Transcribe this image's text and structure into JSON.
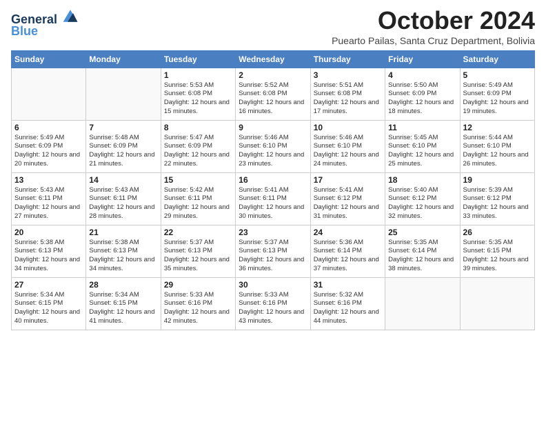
{
  "header": {
    "logo_line1": "General",
    "logo_line2": "Blue",
    "month_title": "October 2024",
    "subtitle": "Puearto Pailas, Santa Cruz Department, Bolivia"
  },
  "weekdays": [
    "Sunday",
    "Monday",
    "Tuesday",
    "Wednesday",
    "Thursday",
    "Friday",
    "Saturday"
  ],
  "weeks": [
    [
      {
        "day": "",
        "info": ""
      },
      {
        "day": "",
        "info": ""
      },
      {
        "day": "1",
        "info": "Sunrise: 5:53 AM\nSunset: 6:08 PM\nDaylight: 12 hours and 15 minutes."
      },
      {
        "day": "2",
        "info": "Sunrise: 5:52 AM\nSunset: 6:08 PM\nDaylight: 12 hours and 16 minutes."
      },
      {
        "day": "3",
        "info": "Sunrise: 5:51 AM\nSunset: 6:08 PM\nDaylight: 12 hours and 17 minutes."
      },
      {
        "day": "4",
        "info": "Sunrise: 5:50 AM\nSunset: 6:09 PM\nDaylight: 12 hours and 18 minutes."
      },
      {
        "day": "5",
        "info": "Sunrise: 5:49 AM\nSunset: 6:09 PM\nDaylight: 12 hours and 19 minutes."
      }
    ],
    [
      {
        "day": "6",
        "info": "Sunrise: 5:49 AM\nSunset: 6:09 PM\nDaylight: 12 hours and 20 minutes."
      },
      {
        "day": "7",
        "info": "Sunrise: 5:48 AM\nSunset: 6:09 PM\nDaylight: 12 hours and 21 minutes."
      },
      {
        "day": "8",
        "info": "Sunrise: 5:47 AM\nSunset: 6:09 PM\nDaylight: 12 hours and 22 minutes."
      },
      {
        "day": "9",
        "info": "Sunrise: 5:46 AM\nSunset: 6:10 PM\nDaylight: 12 hours and 23 minutes."
      },
      {
        "day": "10",
        "info": "Sunrise: 5:46 AM\nSunset: 6:10 PM\nDaylight: 12 hours and 24 minutes."
      },
      {
        "day": "11",
        "info": "Sunrise: 5:45 AM\nSunset: 6:10 PM\nDaylight: 12 hours and 25 minutes."
      },
      {
        "day": "12",
        "info": "Sunrise: 5:44 AM\nSunset: 6:10 PM\nDaylight: 12 hours and 26 minutes."
      }
    ],
    [
      {
        "day": "13",
        "info": "Sunrise: 5:43 AM\nSunset: 6:11 PM\nDaylight: 12 hours and 27 minutes."
      },
      {
        "day": "14",
        "info": "Sunrise: 5:43 AM\nSunset: 6:11 PM\nDaylight: 12 hours and 28 minutes."
      },
      {
        "day": "15",
        "info": "Sunrise: 5:42 AM\nSunset: 6:11 PM\nDaylight: 12 hours and 29 minutes."
      },
      {
        "day": "16",
        "info": "Sunrise: 5:41 AM\nSunset: 6:11 PM\nDaylight: 12 hours and 30 minutes."
      },
      {
        "day": "17",
        "info": "Sunrise: 5:41 AM\nSunset: 6:12 PM\nDaylight: 12 hours and 31 minutes."
      },
      {
        "day": "18",
        "info": "Sunrise: 5:40 AM\nSunset: 6:12 PM\nDaylight: 12 hours and 32 minutes."
      },
      {
        "day": "19",
        "info": "Sunrise: 5:39 AM\nSunset: 6:12 PM\nDaylight: 12 hours and 33 minutes."
      }
    ],
    [
      {
        "day": "20",
        "info": "Sunrise: 5:38 AM\nSunset: 6:13 PM\nDaylight: 12 hours and 34 minutes."
      },
      {
        "day": "21",
        "info": "Sunrise: 5:38 AM\nSunset: 6:13 PM\nDaylight: 12 hours and 34 minutes."
      },
      {
        "day": "22",
        "info": "Sunrise: 5:37 AM\nSunset: 6:13 PM\nDaylight: 12 hours and 35 minutes."
      },
      {
        "day": "23",
        "info": "Sunrise: 5:37 AM\nSunset: 6:13 PM\nDaylight: 12 hours and 36 minutes."
      },
      {
        "day": "24",
        "info": "Sunrise: 5:36 AM\nSunset: 6:14 PM\nDaylight: 12 hours and 37 minutes."
      },
      {
        "day": "25",
        "info": "Sunrise: 5:35 AM\nSunset: 6:14 PM\nDaylight: 12 hours and 38 minutes."
      },
      {
        "day": "26",
        "info": "Sunrise: 5:35 AM\nSunset: 6:15 PM\nDaylight: 12 hours and 39 minutes."
      }
    ],
    [
      {
        "day": "27",
        "info": "Sunrise: 5:34 AM\nSunset: 6:15 PM\nDaylight: 12 hours and 40 minutes."
      },
      {
        "day": "28",
        "info": "Sunrise: 5:34 AM\nSunset: 6:15 PM\nDaylight: 12 hours and 41 minutes."
      },
      {
        "day": "29",
        "info": "Sunrise: 5:33 AM\nSunset: 6:16 PM\nDaylight: 12 hours and 42 minutes."
      },
      {
        "day": "30",
        "info": "Sunrise: 5:33 AM\nSunset: 6:16 PM\nDaylight: 12 hours and 43 minutes."
      },
      {
        "day": "31",
        "info": "Sunrise: 5:32 AM\nSunset: 6:16 PM\nDaylight: 12 hours and 44 minutes."
      },
      {
        "day": "",
        "info": ""
      },
      {
        "day": "",
        "info": ""
      }
    ]
  ]
}
